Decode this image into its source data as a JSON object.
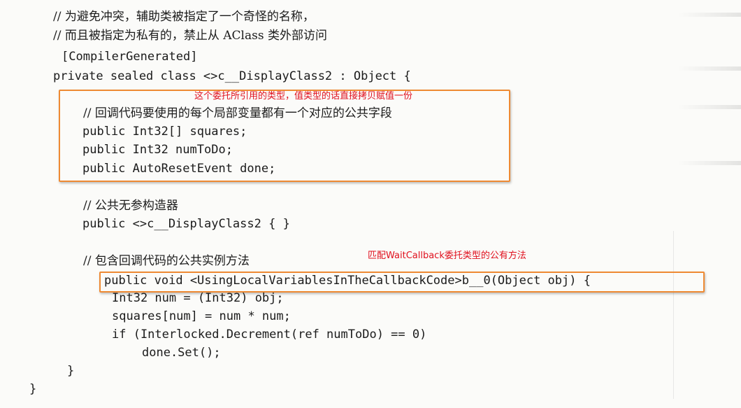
{
  "code": {
    "comment_name": "// 为避免冲突，辅助类被指定了一个奇怪的名称，",
    "comment_private": "// 而且被指定为私有的，禁止从 AClass 类外部访问",
    "attribute": "[CompilerGenerated]",
    "class_decl": "private sealed class <>c__DisplayClass2 : Object {",
    "comment_fields": "// 回调代码要使用的每个局部变量都有一个对应的公共字段",
    "field_squares": "public Int32[] squares;",
    "field_numtodo": "public Int32 numToDo;",
    "field_done": "public AutoResetEvent done;",
    "comment_ctor": "// 公共无参构造器",
    "ctor": "public <>c__DisplayClass2 { }",
    "comment_method": "// 包含回调代码的公共实例方法",
    "method_decl": "public void <UsingLocalVariablesInTheCallbackCode>b__0(Object obj) {",
    "stmt_cast": "Int32 num = (Int32) obj;",
    "stmt_square": "squares[num] = num * num;",
    "stmt_if": "if (Interlocked.Decrement(ref numToDo) == 0)",
    "stmt_set": "done.Set();",
    "close_method": "}",
    "close_class": "}"
  },
  "annotations": {
    "fields_note": "这个委托所引用的类型，值类型的话直接拷贝赋值一份",
    "method_note": "匹配WaitCallback委托类型的公有方法"
  },
  "colors": {
    "annotation_border": "#ee8a33",
    "annotation_text": "#e0101e",
    "ink": "#1b1b1b"
  }
}
